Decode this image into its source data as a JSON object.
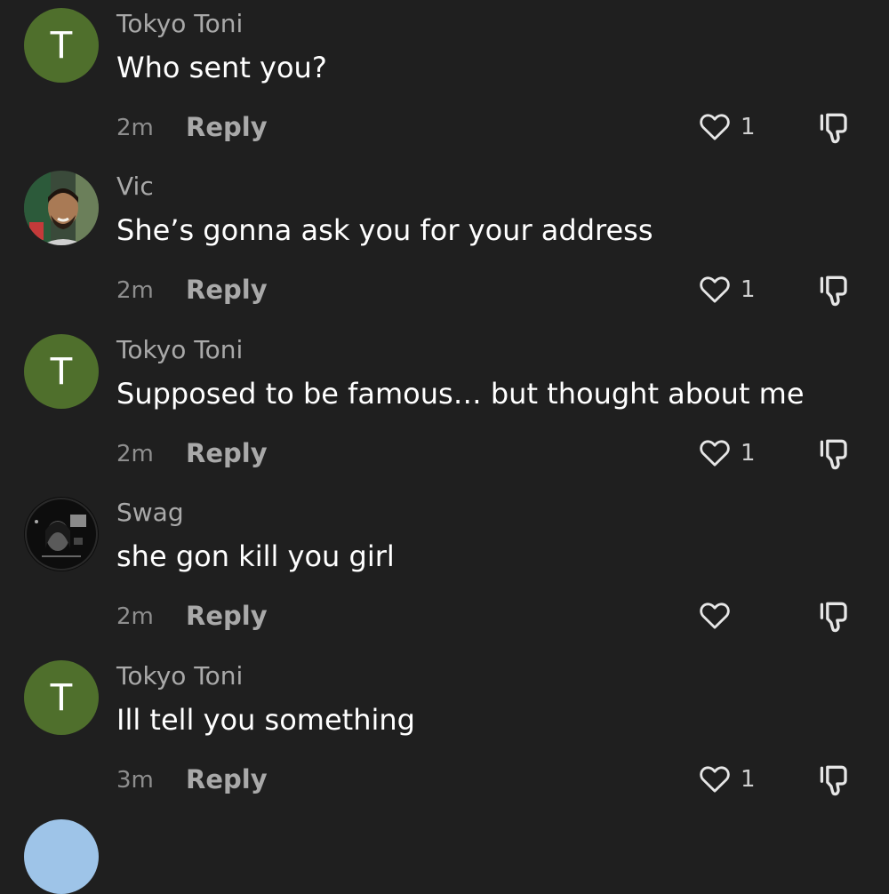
{
  "reply_label": "Reply",
  "comments": [
    {
      "username": "Tokyo Toni",
      "avatar": "T",
      "avatar_type": "letter",
      "avatar_color": "#4f6f2c",
      "text": "Who sent you?",
      "time": "2m",
      "likes": "1"
    },
    {
      "username": "Vic",
      "avatar": "",
      "avatar_type": "photo",
      "text": "She’s gonna ask you for your address",
      "time": "2m",
      "likes": "1"
    },
    {
      "username": "Tokyo Toni",
      "avatar": "T",
      "avatar_type": "letter",
      "avatar_color": "#4f6f2c",
      "text": "Supposed to be famous… but thought about me",
      "time": "2m",
      "likes": "1"
    },
    {
      "username": "Swag",
      "avatar": "",
      "avatar_type": "photo",
      "text": "she gon kill you girl",
      "time": "2m",
      "likes": ""
    },
    {
      "username": "Tokyo Toni",
      "avatar": "T",
      "avatar_type": "letter",
      "avatar_color": "#4f6f2c",
      "text": "Ill tell you something",
      "time": "3m",
      "likes": "1"
    }
  ],
  "icons": {
    "like": "heart-outline-icon",
    "dislike": "thumbs-down-icon"
  },
  "colors": {
    "background": "#1f1f1f",
    "avatar_green": "#4f6f2c"
  }
}
